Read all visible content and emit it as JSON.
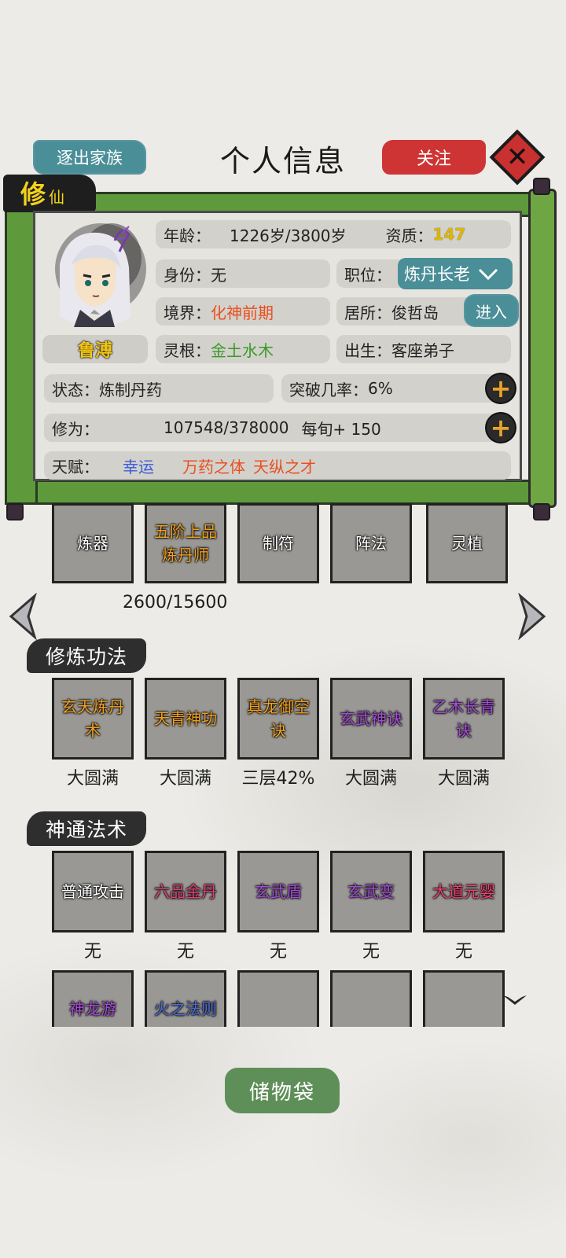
{
  "header": {
    "leave_clan_label": "逐出家族",
    "title": "个人信息",
    "follow_label": "关注",
    "close_icon": "close-icon"
  },
  "cultivation_badge": {
    "main": "修",
    "sub": "仙"
  },
  "profile": {
    "name": "鲁溥",
    "age_label": "年龄：",
    "age_value": "1226岁/3800岁",
    "aptitude_label": "资质：",
    "aptitude_value": "147",
    "identity_label": "身份：",
    "identity_value": "无",
    "position_label": "职位：",
    "position_value": "炼丹长老",
    "realm_label": "境界：",
    "realm_value": "化神前期",
    "residence_label": "居所：",
    "residence_value": "俊哲岛",
    "enter_label": "进入",
    "spirit_root_label": "灵根：",
    "spirit_root_value": "金土水木",
    "origin_label": "出生：",
    "origin_value": "客座弟子",
    "status_label": "状态：",
    "status_value": "炼制丹药",
    "breakthrough_label": "突破几率：",
    "breakthrough_value": "6%",
    "cultivation_label": "修为：",
    "cultivation_value": "107548/378000",
    "per_period": "每旬+ 150",
    "talent_label": "天赋：",
    "talents": [
      "幸运",
      "万药之体",
      "天纵之才"
    ]
  },
  "skills": {
    "tiles": [
      "炼器",
      "五阶上品炼丹师",
      "制符",
      "阵法",
      "灵植"
    ],
    "progress": "2600/15600"
  },
  "techniques": {
    "section_title": "修炼功法",
    "items": [
      {
        "name": "玄天炼丹术",
        "level": "大圆满"
      },
      {
        "name": "天青神功",
        "level": "大圆满"
      },
      {
        "name": "真龙御空诀",
        "level": "三层42%"
      },
      {
        "name": "玄武神诀",
        "level": "大圆满"
      },
      {
        "name": "乙木长青诀",
        "level": "大圆满"
      }
    ]
  },
  "arts": {
    "section_title": "神通法术",
    "row1": [
      {
        "name": "普通攻击",
        "level": "无"
      },
      {
        "name": "六品金丹",
        "level": "无"
      },
      {
        "name": "玄武盾",
        "level": "无"
      },
      {
        "name": "玄武变",
        "level": "无"
      },
      {
        "name": "大道元婴",
        "level": "无"
      }
    ],
    "row2": [
      "神龙游",
      "火之法则",
      "",
      "",
      ""
    ]
  },
  "storage_bag_label": "储物袋",
  "colors": {
    "teal": "#4a8e98",
    "red": "#cf3434",
    "scroll_green": "#5e9a3c",
    "aptitude": "#e0b800",
    "realm": "#e8501e",
    "spirit_root": "#3a9a2a",
    "talent_blue": "#3a5cd8",
    "talent_orange": "#e8501e"
  }
}
